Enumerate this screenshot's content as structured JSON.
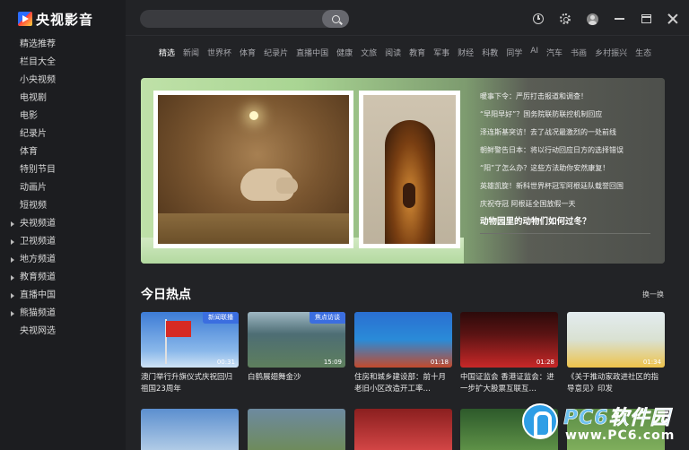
{
  "app": {
    "brand": "央视影音"
  },
  "sidebar": {
    "items": [
      {
        "label": "精选推荐",
        "expandable": false
      },
      {
        "label": "栏目大全",
        "expandable": false
      },
      {
        "label": "小央视频",
        "expandable": false
      },
      {
        "label": "电视剧",
        "expandable": false
      },
      {
        "label": "电影",
        "expandable": false
      },
      {
        "label": "纪录片",
        "expandable": false
      },
      {
        "label": "体育",
        "expandable": false
      },
      {
        "label": "特别节目",
        "expandable": false
      },
      {
        "label": "动画片",
        "expandable": false
      },
      {
        "label": "短视频",
        "expandable": false
      },
      {
        "label": "央视频道",
        "expandable": true
      },
      {
        "label": "卫视频道",
        "expandable": true
      },
      {
        "label": "地方频道",
        "expandable": true
      },
      {
        "label": "教育频道",
        "expandable": true
      },
      {
        "label": "直播中国",
        "expandable": true
      },
      {
        "label": "熊猫频道",
        "expandable": true
      },
      {
        "label": "央视网选",
        "expandable": false
      }
    ]
  },
  "search": {
    "placeholder": ""
  },
  "window_icons": [
    "clock-icon",
    "gear-icon",
    "avatar-icon",
    "minimize-icon",
    "maximize-icon",
    "close-icon"
  ],
  "categories": [
    "精选",
    "新闻",
    "世界杯",
    "体育",
    "纪录片",
    "直播中国",
    "健康",
    "文旅",
    "阅读",
    "教育",
    "军事",
    "财经",
    "科教",
    "同学",
    "AI",
    "汽车",
    "书画",
    "乡村振兴",
    "生态"
  ],
  "active_category": "精选",
  "banner": {
    "headlines": [
      "暖事下令：严厉打击报道和调查！",
      "“早阳早好”？国务院联防联控机制回应",
      "泽连斯基突访！去了战况最激烈的一处前线",
      "朝鲜警告日本：将以行动回应日方的选择错误",
      "“阳”了怎么办？这些方法助你安然康复！",
      "英雄凯旋！新科世界杯冠军阿根廷队载誉回国",
      "庆祝夺冠 阿根廷全国放假一天"
    ],
    "featured": "动物园里的动物们如何过冬？"
  },
  "hot": {
    "title": "今日热点",
    "more": "换一换",
    "cards": [
      {
        "title": "澳门举行升旗仪式庆祝回归祖国23周年",
        "duration": "00:31",
        "tag": "新闻联播"
      },
      {
        "title": "白鹤展翅舞金沙",
        "duration": "15:09",
        "tag": "焦点访谈"
      },
      {
        "title": "住房和城乡建设部：前十月老旧小区改造开工率…",
        "duration": "01:18",
        "tag": ""
      },
      {
        "title": "中国证监会 香港证监会：进一步扩大股票互联互…",
        "duration": "01:28",
        "tag": ""
      },
      {
        "title": "《关于推动家政进社区的指导意见》印发",
        "duration": "01:34",
        "tag": ""
      }
    ]
  },
  "watermark": {
    "text": "PC6软件园",
    "url": "www.PC6.com"
  },
  "colors": {
    "background": "#222326",
    "sidebar": "#1c1d20",
    "tag": "#3b6ee0",
    "text": "#e6e6e6"
  }
}
